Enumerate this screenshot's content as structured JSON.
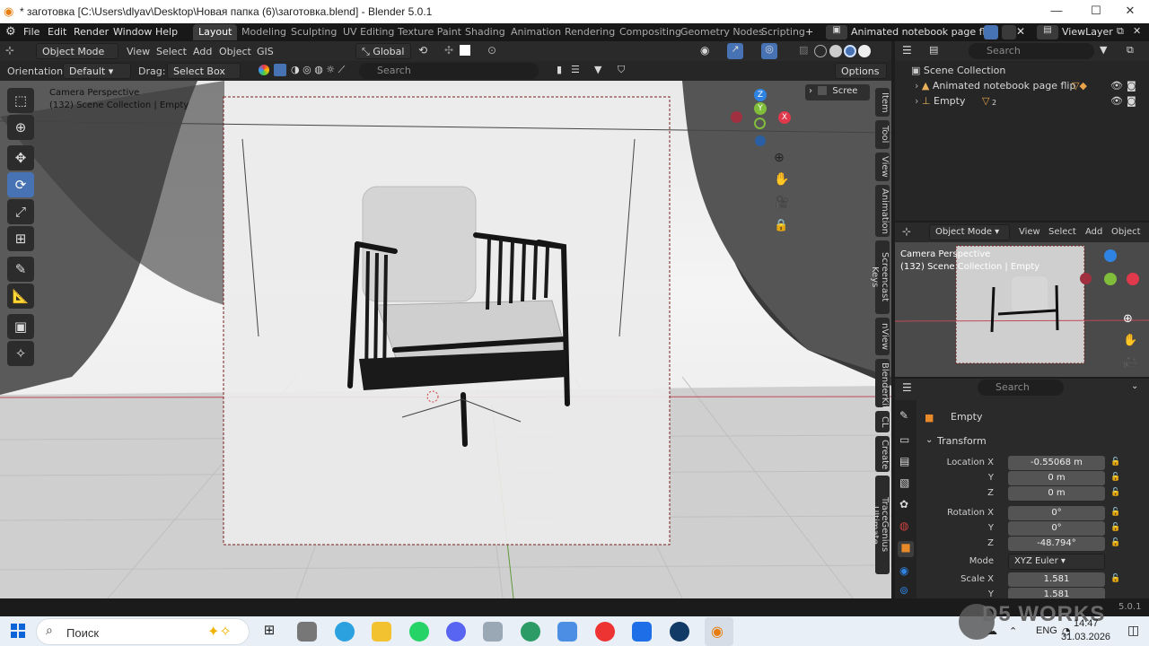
{
  "window": {
    "title": "* заготовка [C:\\Users\\dlyav\\Desktop\\Новая папка (6)\\заготовка.blend] - Blender 5.0.1"
  },
  "menu": {
    "file": "File",
    "edit": "Edit",
    "render": "Render",
    "window": "Window",
    "help": "Help"
  },
  "workspaces": [
    "Layout",
    "Modeling",
    "Sculpting",
    "UV Editing",
    "Texture Paint",
    "Shading",
    "Animation",
    "Rendering",
    "Compositing",
    "Geometry Nodes",
    "Scripting"
  ],
  "add_workspace": "+",
  "scene_name": "Animated notebook page flip",
  "view_layer": "ViewLayer",
  "viewport_header": {
    "mode": "Object Mode",
    "view": "View",
    "select": "Select",
    "add": "Add",
    "object": "Object",
    "gis": "GIS",
    "transform_orientation": "Global"
  },
  "tool_settings": {
    "orientation_label": "Orientation:",
    "orientation_value": "Default",
    "drag_label": "Drag:",
    "drag_value": "Select Box",
    "search_placeholder": "Search",
    "options": "Options"
  },
  "viewport": {
    "info_line1": "Camera Perspective",
    "info_line2": "(132) Scene Collection | Empty",
    "scree_label": "Scree",
    "gizmo": {
      "x": "X",
      "y": "Y",
      "z": "Z"
    }
  },
  "side_tabs": [
    "Item",
    "Tool",
    "View",
    "Animation",
    "Screencast Keys",
    "nView",
    "BlenderKit",
    "CL",
    "Create",
    "TraceGenius Ultimate"
  ],
  "outliner": {
    "search_placeholder": "Search",
    "root": "Scene Collection",
    "items": [
      {
        "label": "Animated notebook page flip"
      },
      {
        "label": "Empty",
        "badge": "2"
      }
    ]
  },
  "mini_viewport": {
    "mode": "Object Mode",
    "view": "View",
    "select": "Select",
    "add": "Add",
    "object": "Object",
    "info_line1": "Camera Perspective",
    "info_line2": "(132) Scene Collection | Empty"
  },
  "properties": {
    "search_placeholder": "Search",
    "object_name": "Empty",
    "panel_title": "Transform",
    "location": {
      "label_x": "Location X",
      "label_y": "Y",
      "label_z": "Z",
      "x": "-0.55068 m",
      "y": "0 m",
      "z": "0 m"
    },
    "rotation": {
      "label_x": "Rotation X",
      "label_y": "Y",
      "label_z": "Z",
      "x": "0°",
      "y": "0°",
      "z": "-48.794°"
    },
    "mode": {
      "label": "Mode",
      "value": "XYZ Euler"
    },
    "scale": {
      "label_x": "Scale X",
      "label_y": "Y",
      "x": "1.581",
      "y": "1.581"
    }
  },
  "status": {
    "version": "5.0.1"
  },
  "taskbar": {
    "search_placeholder": "Поиск",
    "tray_lang": "ENG",
    "time": "14:47",
    "date": "31.03.2026",
    "watermark": "D5 WORKS"
  },
  "colors": {
    "accent": "#4772b3",
    "axis_x": "#e0394c",
    "axis_y": "#7fbd3b",
    "axis_z": "#2f84e3"
  }
}
